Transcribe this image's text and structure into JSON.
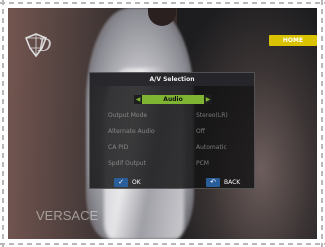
{
  "overlay": {
    "logo_text": "D",
    "channel_badge": "HOME",
    "watermark": "VERSACE"
  },
  "dialog": {
    "title": "A/V Selection",
    "selector_value": "Audio",
    "rows": [
      {
        "label": "Output Mode",
        "value": "Stereo(LR)"
      },
      {
        "label": "Alternate Audio",
        "value": "Off"
      },
      {
        "label": "CA PID",
        "value": "Automatic"
      },
      {
        "label": "Spdif Output",
        "value": "PCM"
      }
    ],
    "ok_label": "OK",
    "back_label": "BACK"
  }
}
